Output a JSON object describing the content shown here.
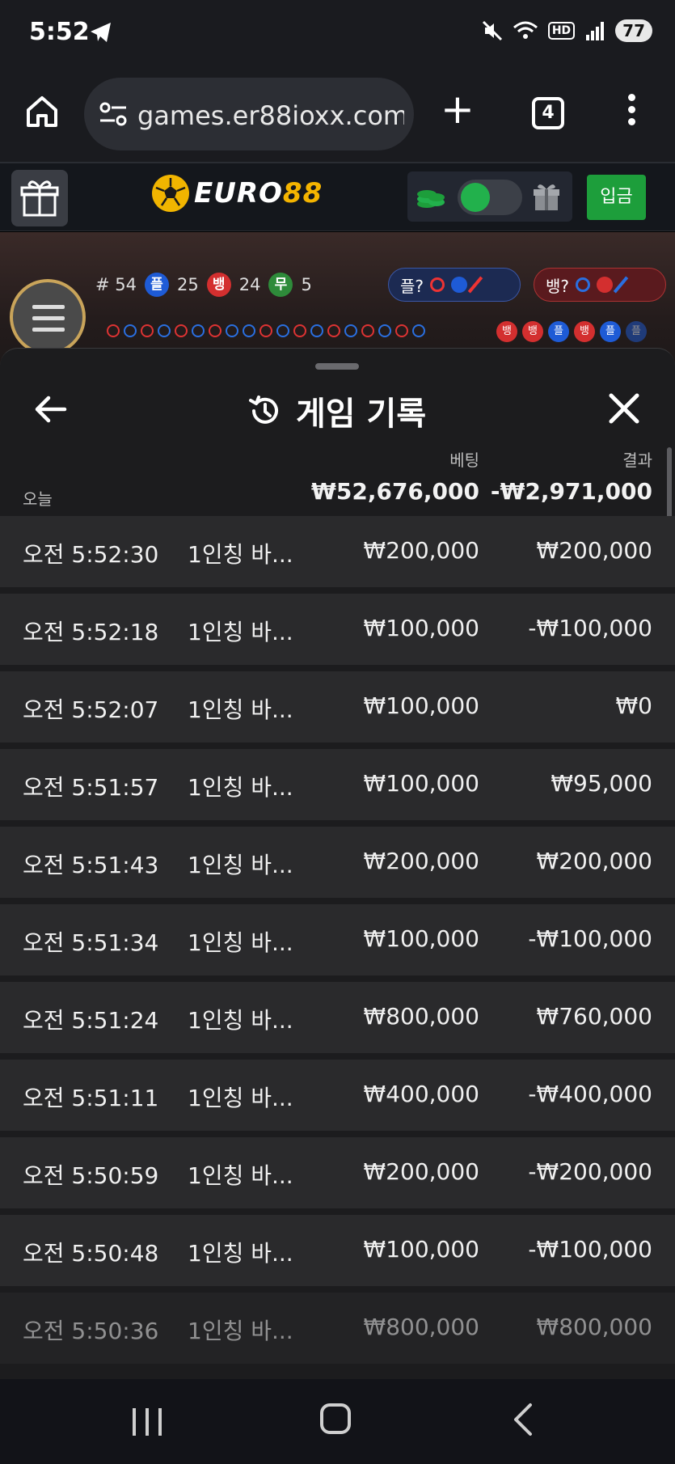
{
  "status_bar": {
    "time": "5:52",
    "battery": "77",
    "hd_label": "HD",
    "icons": [
      "telegram-icon",
      "mute-icon",
      "wifi-icon",
      "signal-icon"
    ]
  },
  "browser": {
    "url": "games.er88ioxx.com",
    "tab_count": "4",
    "icons": [
      "home-icon",
      "tune-icon",
      "plus-icon",
      "more-icon"
    ]
  },
  "site_header": {
    "logo_part1": "EURO",
    "logo_part2": "88",
    "deposit_label": "입금",
    "colors": {
      "brand_yellow": "#f4b400",
      "deposit_green": "#1d9e3b",
      "toggle_green": "#22b14c"
    }
  },
  "game_area": {
    "round": "# 54",
    "player_label": "플",
    "player_count": "25",
    "banker_label": "뱅",
    "banker_count": "24",
    "tie_label": "무",
    "tie_count": "5",
    "player_ask": "플?",
    "banker_ask": "뱅?",
    "trend": [
      "뱅",
      "뱅",
      "플",
      "뱅",
      "플",
      "플"
    ]
  },
  "history": {
    "title": "게임 기록",
    "bet_header": "베팅",
    "result_header": "결과",
    "today_label": "오늘",
    "total_bet": "₩52,676,000",
    "total_result": "-₩2,971,000",
    "rows": [
      {
        "time": "오전 5:52:30",
        "game": "1인칭 바...",
        "bet": "₩200,000",
        "result": "₩200,000"
      },
      {
        "time": "오전 5:52:18",
        "game": "1인칭 바...",
        "bet": "₩100,000",
        "result": "-₩100,000"
      },
      {
        "time": "오전 5:52:07",
        "game": "1인칭 바...",
        "bet": "₩100,000",
        "result": "₩0"
      },
      {
        "time": "오전 5:51:57",
        "game": "1인칭 바...",
        "bet": "₩100,000",
        "result": "₩95,000"
      },
      {
        "time": "오전 5:51:43",
        "game": "1인칭 바...",
        "bet": "₩200,000",
        "result": "₩200,000"
      },
      {
        "time": "오전 5:51:34",
        "game": "1인칭 바...",
        "bet": "₩100,000",
        "result": "-₩100,000"
      },
      {
        "time": "오전 5:51:24",
        "game": "1인칭 바...",
        "bet": "₩800,000",
        "result": "₩760,000"
      },
      {
        "time": "오전 5:51:11",
        "game": "1인칭 바...",
        "bet": "₩400,000",
        "result": "-₩400,000"
      },
      {
        "time": "오전 5:50:59",
        "game": "1인칭 바...",
        "bet": "₩200,000",
        "result": "-₩200,000"
      },
      {
        "time": "오전 5:50:48",
        "game": "1인칭 바...",
        "bet": "₩100,000",
        "result": "-₩100,000"
      },
      {
        "time": "오전 5:50:36",
        "game": "1인칭 바...",
        "bet": "₩800,000",
        "result": "₩800,000"
      }
    ]
  }
}
